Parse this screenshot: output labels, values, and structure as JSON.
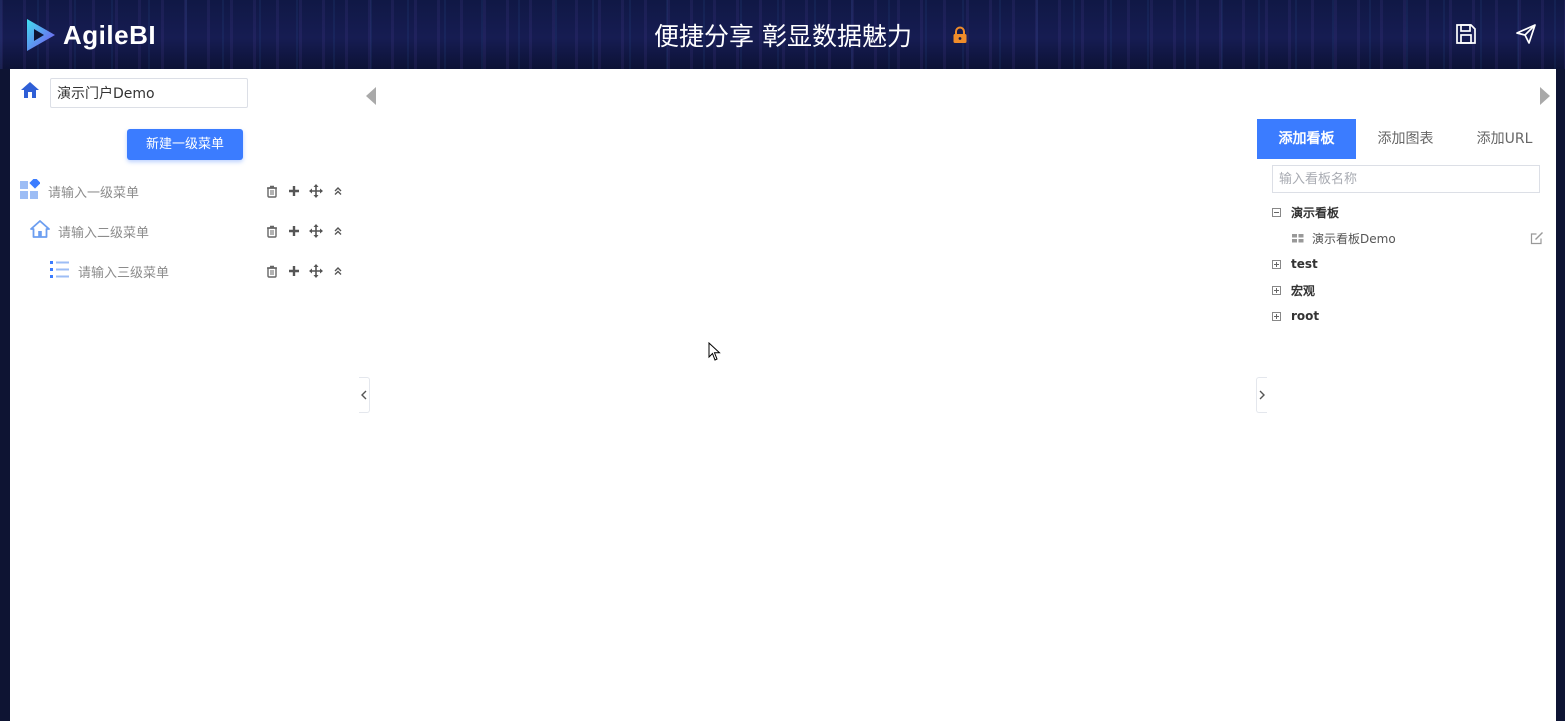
{
  "header": {
    "logo_text": "AgileBI",
    "title": "便捷分享 彰显数据魅力",
    "icons": {
      "lock": "lock-icon",
      "save": "save-icon",
      "publish": "send-icon"
    },
    "lock_color": "#f08c2a"
  },
  "menu_editor": {
    "portal_name": "演示门户Demo",
    "new_menu_button": "新建一级菜单",
    "items": [
      {
        "label": "请输入一级菜单",
        "icon": "dashboard-grid-icon"
      },
      {
        "label": "请输入二级菜单",
        "icon": "home-icon"
      },
      {
        "label": "请输入三级菜单",
        "icon": "list-icon"
      }
    ],
    "row_actions": [
      "trash-icon",
      "plus-icon",
      "move-icon",
      "collapse-up-icon"
    ]
  },
  "right_panel": {
    "tabs": [
      {
        "label": "添加看板",
        "active": true
      },
      {
        "label": "添加图表",
        "active": false
      },
      {
        "label": "添加URL",
        "active": false
      }
    ],
    "search_placeholder": "输入看板名称",
    "tree": [
      {
        "label": "演示看板",
        "expanded": true,
        "children": [
          {
            "label": "演示看板Demo"
          }
        ]
      },
      {
        "label": "test",
        "expanded": false
      },
      {
        "label": "宏观",
        "expanded": false
      },
      {
        "label": "root",
        "expanded": false
      }
    ]
  },
  "colors": {
    "accent": "#3b7cff",
    "header_bg": "#121a4a"
  }
}
